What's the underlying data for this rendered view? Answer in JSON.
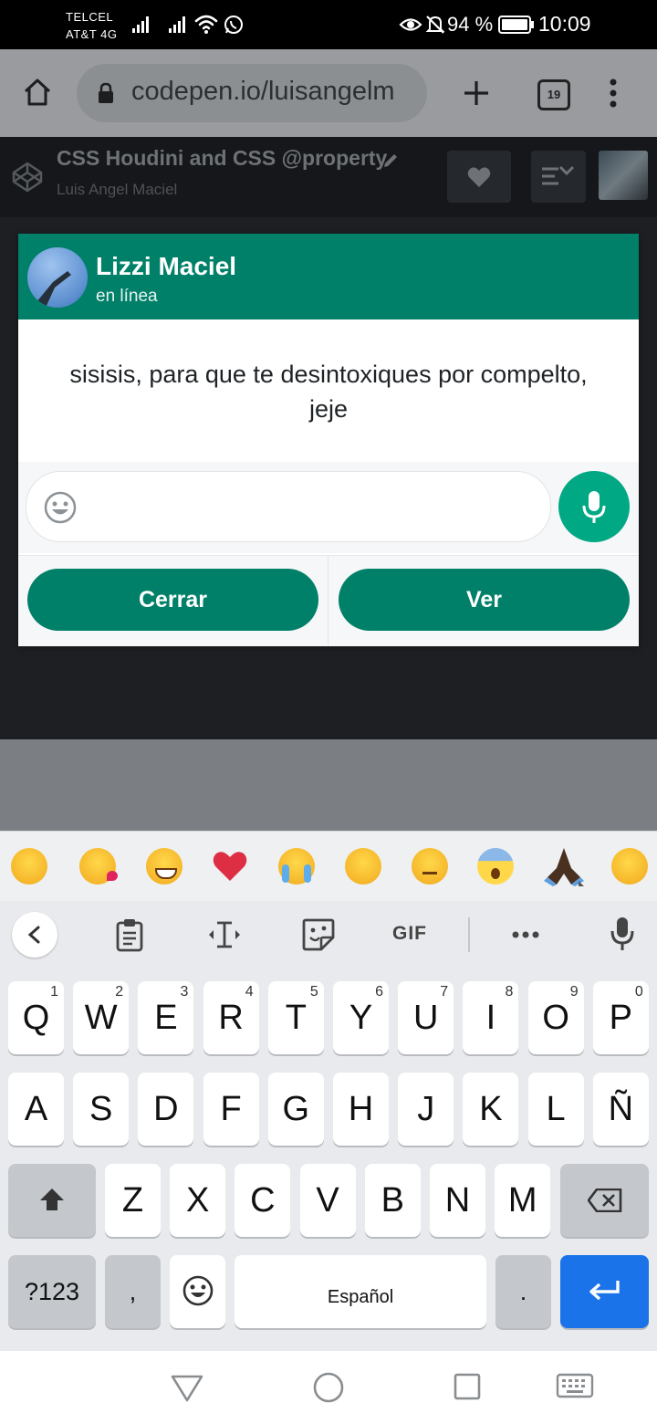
{
  "status_bar": {
    "carrier_line1": "TELCEL",
    "carrier_line2": "AT&T 4G",
    "battery_percent": "94 %",
    "time": "10:09"
  },
  "browser": {
    "url": "codepen.io/luisangelm",
    "tab_count": "19"
  },
  "codepen": {
    "pen_title": "CSS Houdini and CSS @property",
    "author": "Luis Angel Maciel"
  },
  "popup": {
    "contact_name": "Lizzi Maciel",
    "contact_status": "en línea",
    "message": "sisisis, para que te desintoxiques por compelto, jeje",
    "close_label": "Cerrar",
    "view_label": "Ver",
    "accent_color": "#008069"
  },
  "keyboard": {
    "emoji_suggestions": [
      "face-with-tears-of-joy",
      "face-blowing-kiss",
      "grinning-face",
      "red-heart",
      "loudly-crying-face",
      "drooling-face",
      "unamused-face",
      "face-screaming-in-fear",
      "folded-hands",
      "rolling-on-floor-laughing"
    ],
    "gif_label": "GIF",
    "row1": [
      {
        "k": "Q",
        "n": "1"
      },
      {
        "k": "W",
        "n": "2"
      },
      {
        "k": "E",
        "n": "3"
      },
      {
        "k": "R",
        "n": "4"
      },
      {
        "k": "T",
        "n": "5"
      },
      {
        "k": "Y",
        "n": "6"
      },
      {
        "k": "U",
        "n": "7"
      },
      {
        "k": "I",
        "n": "8"
      },
      {
        "k": "O",
        "n": "9"
      },
      {
        "k": "P",
        "n": "0"
      }
    ],
    "row2": [
      "A",
      "S",
      "D",
      "F",
      "G",
      "H",
      "J",
      "K",
      "L",
      "Ñ"
    ],
    "row3": [
      "Z",
      "X",
      "C",
      "V",
      "B",
      "N",
      "M"
    ],
    "symbols_label": "?123",
    "comma_label": ",",
    "space_label": "Español",
    "period_label": "."
  }
}
